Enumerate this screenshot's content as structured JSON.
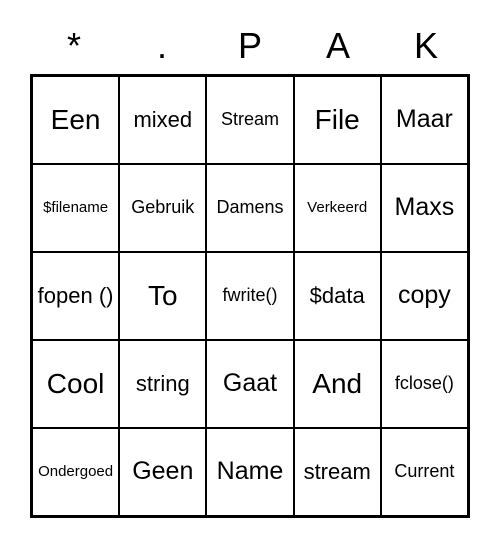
{
  "header": [
    "*",
    ".",
    "P",
    "A",
    "K"
  ],
  "cells": [
    [
      {
        "text": "Een",
        "size": "xl"
      },
      {
        "text": "mixed",
        "size": "md"
      },
      {
        "text": "Stream",
        "size": "sm"
      },
      {
        "text": "File",
        "size": "xl"
      },
      {
        "text": "Maar",
        "size": "lg"
      }
    ],
    [
      {
        "text": "$filename",
        "size": "xs"
      },
      {
        "text": "Gebruik",
        "size": "sm"
      },
      {
        "text": "Damens",
        "size": "sm"
      },
      {
        "text": "Verkeerd",
        "size": "xs"
      },
      {
        "text": "Maxs",
        "size": "lg"
      }
    ],
    [
      {
        "text": "fopen ()",
        "size": "md"
      },
      {
        "text": "To",
        "size": "xl"
      },
      {
        "text": "fwrite()",
        "size": "sm"
      },
      {
        "text": "$data",
        "size": "md"
      },
      {
        "text": "copy",
        "size": "lg"
      }
    ],
    [
      {
        "text": "Cool",
        "size": "xl"
      },
      {
        "text": "string",
        "size": "md"
      },
      {
        "text": "Gaat",
        "size": "lg"
      },
      {
        "text": "And",
        "size": "xl"
      },
      {
        "text": "fclose()",
        "size": "sm"
      }
    ],
    [
      {
        "text": "Ondergoed",
        "size": "xs"
      },
      {
        "text": "Geen",
        "size": "lg"
      },
      {
        "text": "Name",
        "size": "lg"
      },
      {
        "text": "stream",
        "size": "md"
      },
      {
        "text": "Current",
        "size": "sm"
      }
    ]
  ]
}
